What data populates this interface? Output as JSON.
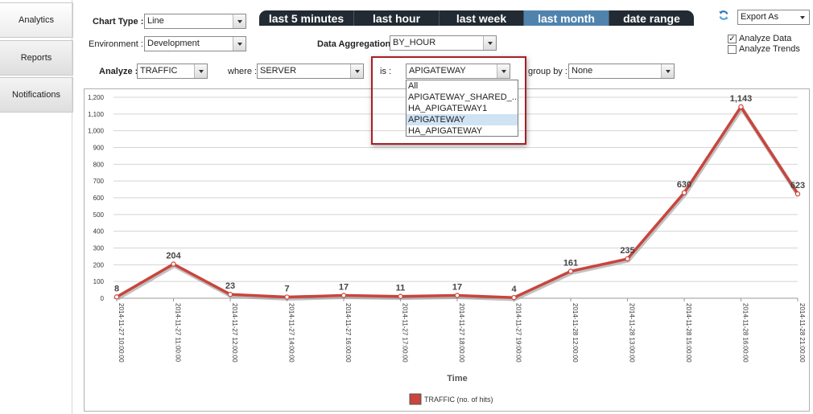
{
  "nav": {
    "tabs": [
      {
        "label": "Analytics",
        "active": true
      },
      {
        "label": "Reports",
        "active": false
      },
      {
        "label": "Notifications",
        "active": false
      }
    ]
  },
  "form": {
    "chart_type": {
      "label": "Chart Type :",
      "value": "Line"
    },
    "environment": {
      "label": "Environment :",
      "value": "Development"
    },
    "data_aggregation": {
      "label": "Data Aggregation :",
      "value": "BY_HOUR"
    },
    "analyze": {
      "label": "Analyze :",
      "value": "TRAFFIC"
    },
    "where": {
      "label": "where :",
      "value": "SERVER"
    },
    "is": {
      "label": "is :",
      "value": "APIGATEWAY",
      "options": [
        "All",
        "APIGATEWAY_SHARED_...",
        "HA_APIGATEWAY1",
        "APIGATEWAY",
        "HA_APIGATEWAY"
      ],
      "highlighted": "APIGATEWAY"
    },
    "group_by": {
      "label": "group by :",
      "value": "None"
    }
  },
  "ranges": [
    {
      "label": "last 5 minutes",
      "active": false
    },
    {
      "label": "last hour",
      "active": false
    },
    {
      "label": "last week",
      "active": false
    },
    {
      "label": "last month",
      "active": true
    },
    {
      "label": "date range",
      "active": false
    }
  ],
  "toolbar": {
    "refresh_icon": "refresh-icon",
    "export_label": "Export As",
    "analyze_data": {
      "label": "Analyze Data",
      "checked": true
    },
    "analyze_trends": {
      "label": "Analyze Trends",
      "checked": false
    }
  },
  "colors": {
    "series_line": "#c9453d",
    "active_tab": "#4f83ad",
    "tab_bg": "#222b33",
    "popup_border": "#a62026"
  },
  "chart_data": {
    "type": "line",
    "x": [
      "2014-11-27 10:00:00",
      "2014-11-27 11:00:00",
      "2014-11-27 12:00:00",
      "2014-11-27 14:00:00",
      "2014-11-27 16:00:00",
      "2014-11-27 17:00:00",
      "2014-11-27 18:00:00",
      "2014-11-27 19:00:00",
      "2014-11-28 12:00:00",
      "2014-11-28 13:00:00",
      "2014-11-28 15:00:00",
      "2014-11-28 16:00:00",
      "2014-11-28 21:00:00"
    ],
    "series": [
      {
        "name": "TRAFFIC (no. of hits)",
        "values": [
          8,
          204,
          23,
          7,
          17,
          11,
          17,
          4,
          161,
          235,
          630,
          1143,
          623
        ],
        "labels": [
          "8",
          "204",
          "23",
          "7",
          "17",
          "11",
          "17",
          "4",
          "161",
          "235",
          "630",
          "1,143",
          "623"
        ]
      }
    ],
    "xlabel": "Time",
    "ylabel": "",
    "ylim": [
      0,
      1200
    ],
    "yticks": [
      0,
      100,
      200,
      300,
      400,
      500,
      600,
      700,
      800,
      900,
      1000,
      1100,
      1200
    ],
    "ytick_labels": [
      "0",
      "100",
      "200",
      "300",
      "400",
      "500",
      "600",
      "700",
      "800",
      "900",
      "1,000",
      "1,100",
      "1,200"
    ],
    "grid": true,
    "legend": "bottom-center"
  }
}
